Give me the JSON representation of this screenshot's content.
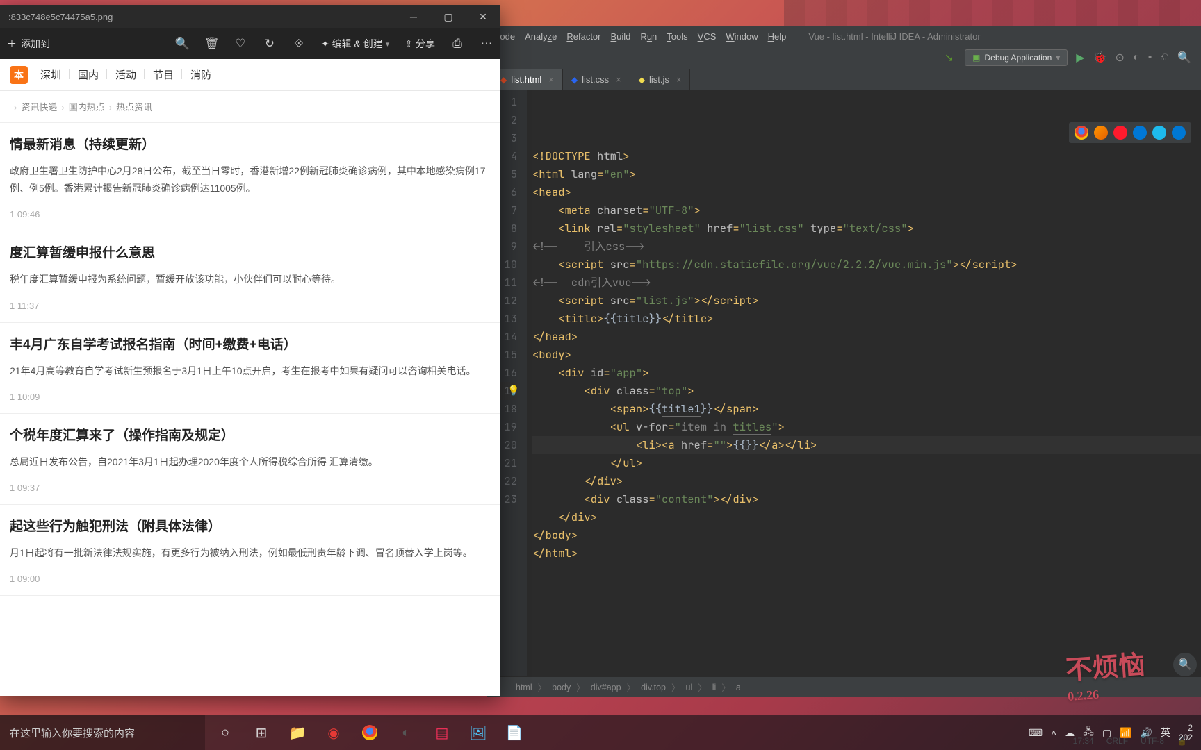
{
  "viewer": {
    "title": ":833c748e5c74475a5.png",
    "add_label": "添加到",
    "edit_create_label": "编辑 & 创建",
    "share_label": "分享",
    "nav_items": [
      "深圳",
      "国内",
      "活动",
      "节目",
      "消防"
    ],
    "breadcrumbs": [
      "",
      "资讯快递",
      "国内热点",
      "热点资讯"
    ],
    "articles": [
      {
        "title": "情最新消息（持续更新）",
        "body": "政府卫生署卫生防护中心2月28日公布，截至当日零时，香港新增22例新冠肺炎确诊病例，其中本地感染病例17例、例5例。香港累计报告新冠肺炎确诊病例达11005例。",
        "time": "1 09:46"
      },
      {
        "title": "度汇算暂缓申报什么意思",
        "body": "税年度汇算暂缓申报为系统问题，暂缓开放该功能，小伙伴们可以耐心等待。",
        "time": "1 11:37"
      },
      {
        "title": "丰4月广东自学考试报名指南（时间+缴费+电话）",
        "body": "21年4月高等教育自学考试新生预报名于3月1日上午10点开启，考生在报考中如果有疑问可以咨询相关电话。",
        "time": "1 10:09"
      },
      {
        "title": "个税年度汇算来了（操作指南及规定）",
        "body": "总局近日发布公告，自2021年3月1日起办理2020年度个人所得税综合所得 汇算清缴。",
        "time": "1 09:37"
      },
      {
        "title": "起这些行为触犯刑法（附具体法律）",
        "body": "月1日起将有一批新法律法规实施，有更多行为被纳入刑法，例如最低刑责年龄下调、冒名顶替入学上岗等。",
        "time": "1 09:00"
      }
    ]
  },
  "ide": {
    "menus": [
      "Code",
      "Analyze",
      "Refactor",
      "Build",
      "Run",
      "Tools",
      "VCS",
      "Window",
      "Help"
    ],
    "menu_underlines": [
      "C",
      "z",
      "R",
      "B",
      "u",
      "T",
      "V",
      "W",
      "H"
    ],
    "window_title": "Vue - list.html - IntelliJ IDEA - Administrator",
    "run_config": "Debug Application",
    "tabs": [
      {
        "name": "list.html",
        "type": "html",
        "active": true
      },
      {
        "name": "list.css",
        "type": "css",
        "active": false
      },
      {
        "name": "list.js",
        "type": "js",
        "active": false
      }
    ],
    "code": [
      {
        "n": 1,
        "h": "<span class='tag'>&lt;!DOCTYPE <span class='attr'>html</span>&gt;</span>"
      },
      {
        "n": 2,
        "h": "<span class='tag'>&lt;html <span class='attr'>lang</span>=<span class='str'>\"en\"</span>&gt;</span>"
      },
      {
        "n": 3,
        "h": "<span class='tag'>&lt;head&gt;</span>"
      },
      {
        "n": 4,
        "h": "    <span class='tag'>&lt;meta <span class='attr'>charset</span>=<span class='str'>\"UTF-8\"</span>&gt;</span>"
      },
      {
        "n": 5,
        "h": "    <span class='tag'>&lt;link <span class='attr'>rel</span>=<span class='str'>\"stylesheet\"</span> <span class='attr'>href</span>=<span class='str'>\"list.css\"</span> <span class='attr'>type</span>=<span class='str'>\"text/css\"</span>&gt;</span>"
      },
      {
        "n": 6,
        "h": "<span class='cmt'>&lt;!--    引入css--&gt;</span>"
      },
      {
        "n": 7,
        "h": "    <span class='tag'>&lt;script <span class='attr'>src</span>=<span class='str'>\"<span class='under'>https://cdn.staticfile.org/vue/2.2.2/vue.min.js</span>\"</span>&gt;&lt;/script&gt;</span>"
      },
      {
        "n": 8,
        "h": "<span class='cmt'>&lt;!--  cdn引入vue--&gt;</span>"
      },
      {
        "n": 9,
        "h": "    <span class='tag'>&lt;script <span class='attr'>src</span>=<span class='str'>\"list.js\"</span>&gt;&lt;/script&gt;</span>"
      },
      {
        "n": 10,
        "h": "    <span class='tag'>&lt;title&gt;</span>{{<span class='under'>title</span>}}<span class='tag'>&lt;/title&gt;</span>"
      },
      {
        "n": 11,
        "h": "<span class='tag'>&lt;/head&gt;</span>"
      },
      {
        "n": 12,
        "h": "<span class='tag'>&lt;body&gt;</span>"
      },
      {
        "n": 13,
        "h": "    <span class='tag'>&lt;div <span class='attr'>id</span>=<span class='str'>\"app\"</span>&gt;</span>"
      },
      {
        "n": 14,
        "h": "        <span class='tag'>&lt;div <span class='attr'>class</span>=<span class='str'>\"top\"</span>&gt;</span>"
      },
      {
        "n": 15,
        "h": "            <span class='tag'>&lt;span&gt;</span>{{<span class='under'>title1</span>}}<span class='tag'>&lt;/span&gt;</span>"
      },
      {
        "n": 16,
        "h": "            <span class='tag'>&lt;ul <span class='attr'>v-for</span>=<span class='str'>\"<span class='cmt'>item in</span> <span class='under'>titles</span>\"</span>&gt;</span>"
      },
      {
        "n": 17,
        "h": "                <span class='tag'>&lt;li&gt;&lt;a <span class='attr'>href</span>=<span class='str'>\"\"</span>&gt;</span>{{}}<span class='tag'>&lt;/a&gt;&lt;/li&gt;</span>",
        "caret": true
      },
      {
        "n": 18,
        "h": "            <span class='tag'>&lt;/ul&gt;</span>"
      },
      {
        "n": 19,
        "h": "        <span class='tag'>&lt;/div&gt;</span>"
      },
      {
        "n": 20,
        "h": "        <span class='tag'>&lt;div <span class='attr'>class</span>=<span class='str'>\"content\"</span>&gt;&lt;/div&gt;</span>"
      },
      {
        "n": 21,
        "h": "    <span class='tag'>&lt;/div&gt;</span>"
      },
      {
        "n": 22,
        "h": "<span class='tag'>&lt;/body&gt;</span>"
      },
      {
        "n": 23,
        "h": "<span class='tag'>&lt;/html&gt;</span>"
      }
    ],
    "breadcrumbs": [
      "html",
      "body",
      "div#app",
      "div.top",
      "ul",
      "li",
      "a"
    ],
    "status": {
      "col": "17:34",
      "eol": "CRLF",
      "enc": "UTF-8"
    }
  },
  "taskbar": {
    "search_placeholder": "在这里输入你要搜索的内容",
    "tray": {
      "ime": "英",
      "time_top": "2",
      "time_bot": "202"
    }
  },
  "signature": {
    "main": "不烦恼",
    "sub": "0.2.26"
  },
  "colors": {
    "ide_bg": "#2b2b2b",
    "ide_chrome": "#3c3f41",
    "accent": "#f97316"
  }
}
